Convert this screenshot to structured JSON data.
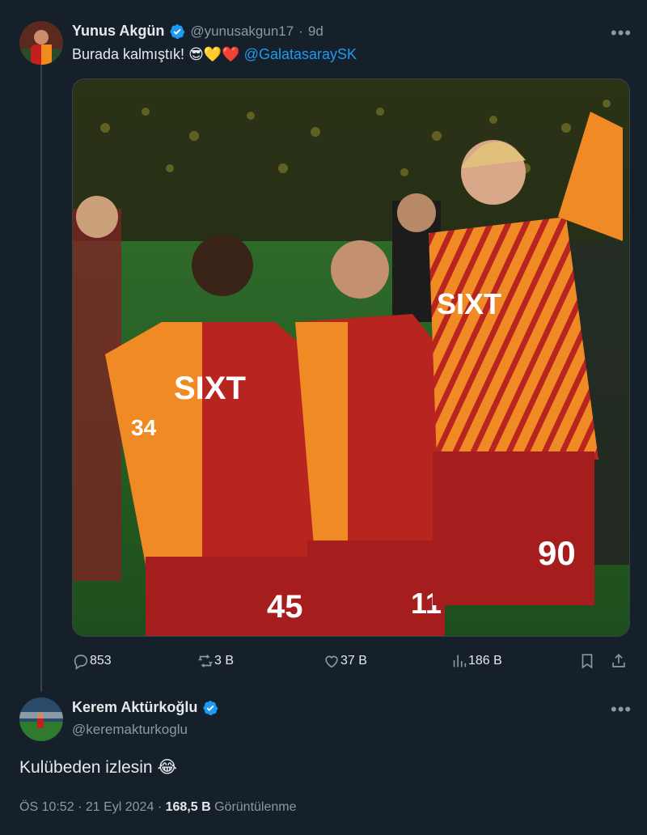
{
  "tweet1": {
    "display_name": "Yunus Akgün",
    "handle": "@yunusakgun17",
    "separator": "·",
    "time": "9d",
    "text": "Burada kalmıştık! ",
    "emojis": "😎💛❤️",
    "mention": "@GalatasaraySK",
    "media": {
      "jersey_sponsor": "SIXT",
      "numbers": [
        "45",
        "11",
        "90",
        "34"
      ]
    },
    "actions": {
      "reply": "853",
      "retweet": "3 B",
      "like": "37 B",
      "views": "186 B"
    }
  },
  "tweet2": {
    "display_name": "Kerem Aktürkoğlu",
    "handle": "@keremakturkoglu",
    "text": "Kulübeden izlesin ",
    "emoji": "😂",
    "time": "ÖS 10:52",
    "date": "21 Eyl 2024",
    "views_count": "168,5 B",
    "views_label": "Görüntülenme",
    "separator": "·"
  },
  "colors": {
    "background": "#15202b",
    "accent": "#1d9bf0",
    "muted": "#8b98a5",
    "galatasaray_red": "#a4161a",
    "galatasaray_orange": "#f28a1e"
  },
  "icons": [
    "more-icon",
    "verified-icon",
    "reply-icon",
    "retweet-icon",
    "like-icon",
    "views-icon",
    "bookmark-icon",
    "share-icon"
  ]
}
